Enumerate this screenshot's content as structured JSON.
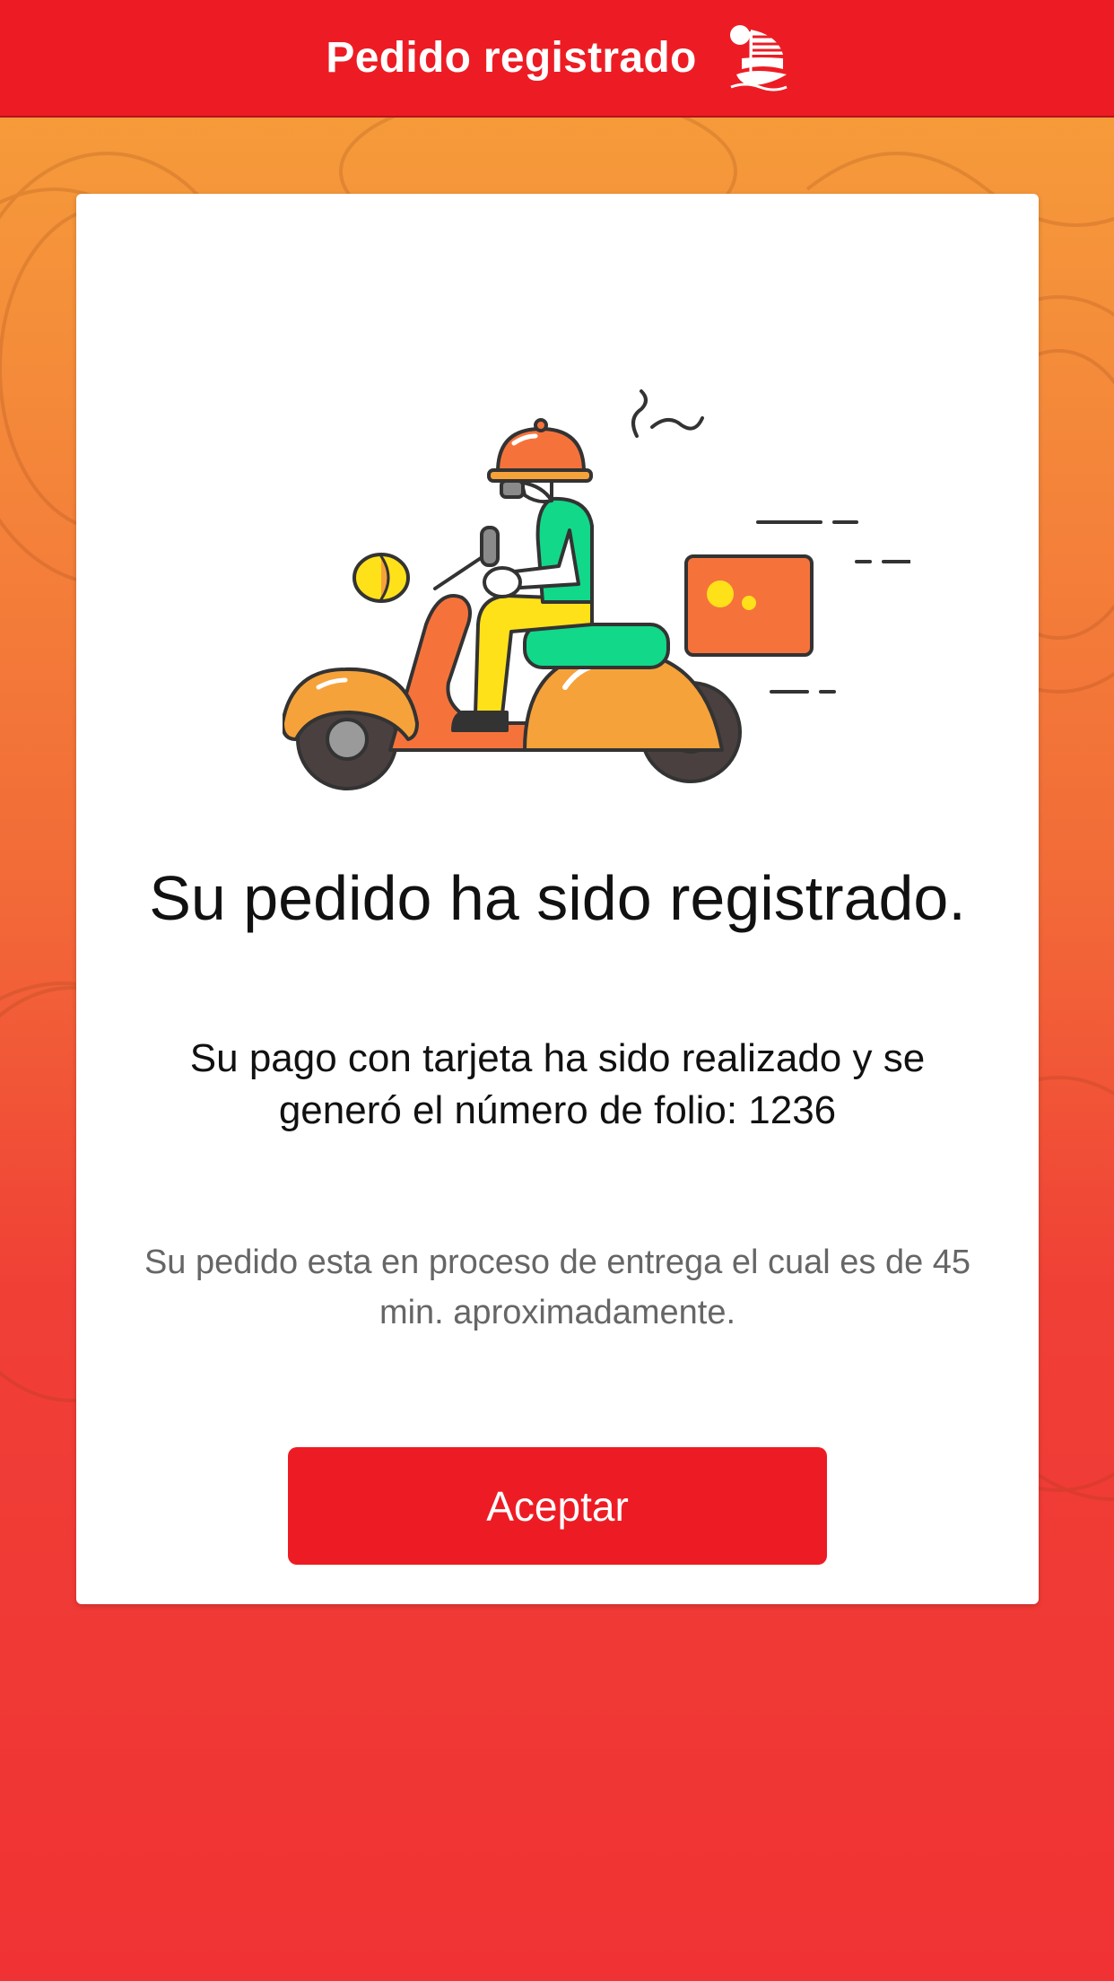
{
  "header": {
    "title": "Pedido registrado"
  },
  "card": {
    "title": "Su pedido ha sido registrado.",
    "payment_message": "Su pago con tarjeta ha sido realizado y se generó el número de folio: 1236",
    "delivery_message": "Su pedido esta en proceso de entrega el cual es de 45 min. aproximadamente.",
    "accept_label": "Aceptar"
  },
  "colors": {
    "brand_red": "#ed1c24",
    "background_top": "#f6a23a",
    "background_bottom": "#f03234"
  },
  "icons": {
    "logo": "junk-boat-logo-icon",
    "illustration": "delivery-scooter-icon"
  }
}
